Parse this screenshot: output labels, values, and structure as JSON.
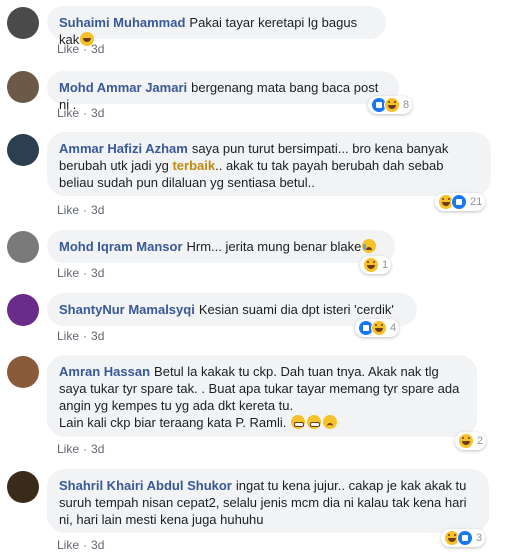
{
  "meta": {
    "like_label": "Like",
    "separator": "·",
    "time": "3d"
  },
  "comments": [
    {
      "author": "Suhaimi Muhammad",
      "text": "Pakai tayar keretapi lg bagus kak",
      "avatar_color": "#4a4a4a"
    },
    {
      "author": "Mohd Ammar Jamari",
      "text": "bergenang mata bang baca post ni .",
      "reactions_count": "8",
      "avatar_color": "#6b5a48"
    },
    {
      "author": "Ammar Hafizi Azham",
      "text_before": "saya pun turut bersimpati... bro kena banyak berubah utk jadi yg ",
      "highlight": "terbaik",
      "text_after": ".. akak tu tak payah berubah dah sebab beliau sudah pun dilaluan yg sentiasa betul..",
      "reactions_count": "21",
      "avatar_color": "#2c3e50"
    },
    {
      "author": "Mohd Iqram Mansor",
      "text": "Hrm... jerita mung benar blake",
      "reactions_count": "1",
      "avatar_color": "#7a7a7a"
    },
    {
      "author": "ShantyNur Mamalsyqi",
      "text": "Kesian suami dia dpt isteri 'cerdik'",
      "reactions_count": "4",
      "avatar_color": "#6a2c8a"
    },
    {
      "author": "Amran Hassan",
      "text": "Betul la kakak tu ckp. Dah tuan tnya. Akak nak tlg saya tukar tyr spare tak. . Buat apa tukar tayar memang tyr spare ada angin yg kempes tu yg ada dkt kereta tu.",
      "text_line2": "Lain kali ckp biar teraang kata P. Ramli.",
      "reactions_count": "2",
      "avatar_color": "#8a5a3a"
    },
    {
      "author": "Shahril Khairi Abdul Shukor",
      "text": "ingat tu kena jujur.. cakap je kak akak tu suruh tempah nisan cepat2, selalu jenis mcm dia ni kalau tak kena hari ni, hari lain mesti kena juga huhuhu",
      "reactions_count": "3",
      "avatar_color": "#3a2a1a"
    }
  ]
}
